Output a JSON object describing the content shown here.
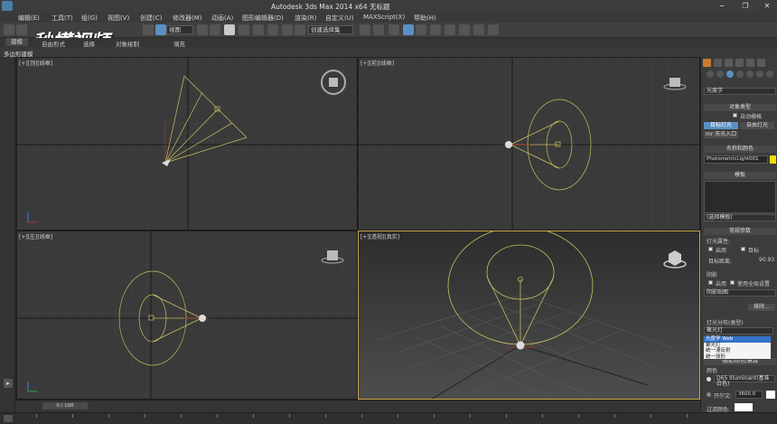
{
  "window": {
    "title": "Autodesk 3ds Max  2014 x64      无标题",
    "minimize": "−",
    "maximize": "❐",
    "close": "✕"
  },
  "menu": [
    "编辑(E)",
    "工具(T)",
    "组(G)",
    "视图(V)",
    "创建(C)",
    "修改器(M)",
    "动画(A)",
    "图形编辑器(D)",
    "渲染(R)",
    "自定义(U)",
    "MAXScript(X)",
    "帮助(H)"
  ],
  "toolbar": {
    "view_select": "视图",
    "selection_set": "创建选择集"
  },
  "watermark": "秒懂视频",
  "ribbon": {
    "tabs": [
      "建模",
      "自由形式",
      "选择",
      "对象绘制",
      "填充"
    ],
    "sub_label": "多边形建模"
  },
  "viewports": {
    "top": "[+][顶][线框]",
    "front": "[+][前][线框]",
    "left": "[+][左][线框]",
    "perspective": "[+][透视][真实]"
  },
  "panel": {
    "category_select": "光度学",
    "object_type_header": "对象类型",
    "auto_grid": "自动栅格",
    "target_light": "目标灯光",
    "free_light": "自由灯光",
    "sun_portal": "mr 天光入口",
    "name_color_header": "名称和颜色",
    "light_name": "PhotometricLight001",
    "light_color": "#f0dc00",
    "template_header": "模板",
    "template_select": "(选择模板)",
    "general_params_header": "常规参数",
    "light_props_label": "灯光属性:",
    "enable_label": "启用",
    "target_label": "目标",
    "target_distance_label": "目标距离:",
    "target_distance_value": "90.93",
    "shadow_label": "阴影",
    "shadow_enable_label": "启用",
    "use_global_label": "使用全局设置",
    "shadow_type": "阴影贴图",
    "exclude_button": "排除...",
    "distribution_label": "灯光分布(类型)",
    "distribution_value": "聚光灯",
    "distribution_options": [
      "光度学 Web",
      "聚光灯",
      "统一漫反射",
      "统一球形"
    ],
    "intensity_header": "强度/颜色/衰减",
    "color_label": "颜色",
    "color_select": "D65 Illuminant(基准白色)",
    "kelvin_label": "开尔文:",
    "kelvin_value": "3600.0",
    "filter_color_label": "过滤颜色:"
  },
  "timeline": {
    "frame": "0 / 100"
  }
}
